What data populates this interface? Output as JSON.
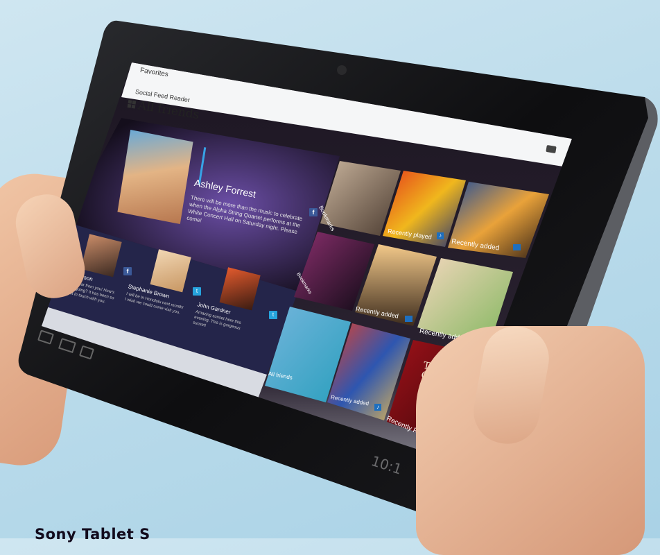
{
  "header": {
    "favorites": "Favorites",
    "app_name": "Social Feed Reader",
    "title": "All friends"
  },
  "feature": {
    "name": "Ashley Forrest",
    "message": "There will be more than the music to celebrate when the Alpha String Quartet performs at the White Concert Hall on Saturday night. Please come!"
  },
  "friends": [
    {
      "name": "Paul Emerson",
      "message": "So glad to hear from you! How's everything going? It has been so long to get in touch with you."
    },
    {
      "name": "Stephanie Brown",
      "message": "I will be in Honolulu next month! I wish we could come visit you."
    },
    {
      "name": "John Gardner",
      "message": "Amazing sunset here this evening. This is gorgeous sunset!"
    }
  ],
  "tiles": [
    {
      "label": "Bookmarks"
    },
    {
      "label": "Recently played"
    },
    {
      "label": "Recently added"
    },
    {
      "label": "Bookmarks"
    },
    {
      "label": "Recently added"
    },
    {
      "label": "Recently added"
    },
    {
      "label": "All friends"
    },
    {
      "label": "Recently added"
    },
    {
      "label": "Recently Read"
    }
  ],
  "book_cover": {
    "author": "TESS GERRITSEN"
  },
  "clock": "10:1",
  "caption": "Sony Tablet S"
}
